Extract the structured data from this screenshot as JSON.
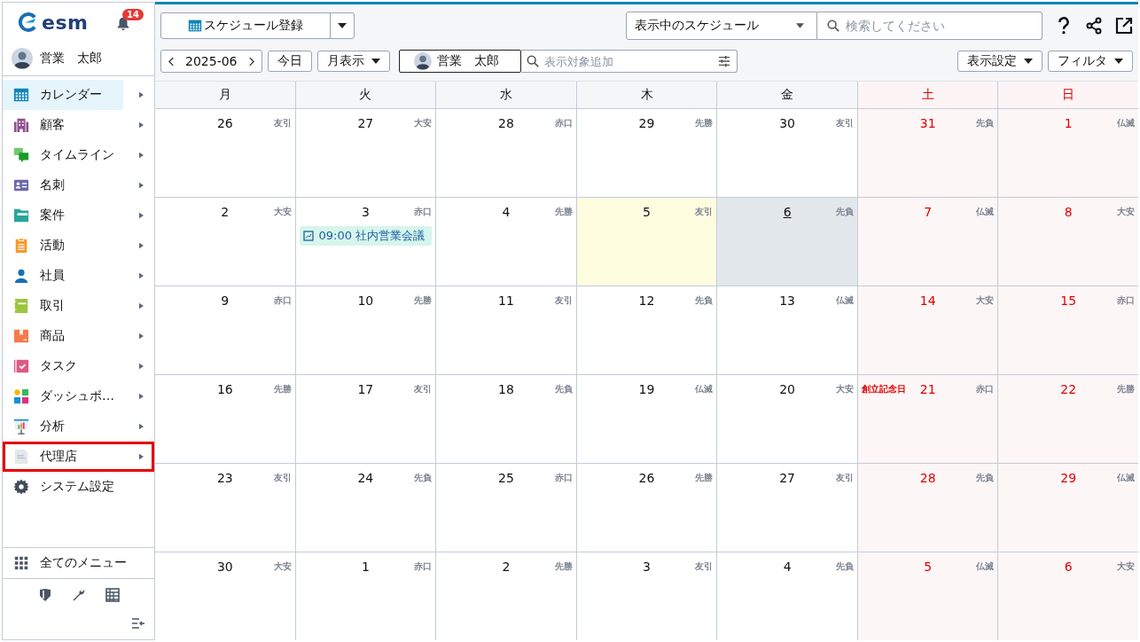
{
  "sidebar": {
    "logo": "esm",
    "notification_count": "14",
    "user": "営業　太郎",
    "items": [
      {
        "label": "カレンダー",
        "kind": "calendar",
        "selected": true,
        "highlighted": false,
        "submenu": true
      },
      {
        "label": "顧客",
        "kind": "building",
        "selected": false,
        "highlighted": false,
        "submenu": true
      },
      {
        "label": "タイムライン",
        "kind": "chat",
        "selected": false,
        "highlighted": false,
        "submenu": true
      },
      {
        "label": "名刺",
        "kind": "card",
        "selected": false,
        "highlighted": false,
        "submenu": true
      },
      {
        "label": "案件",
        "kind": "folder",
        "selected": false,
        "highlighted": false,
        "submenu": true
      },
      {
        "label": "活動",
        "kind": "clipboard",
        "selected": false,
        "highlighted": false,
        "submenu": true
      },
      {
        "label": "社員",
        "kind": "person",
        "selected": false,
        "highlighted": false,
        "submenu": true
      },
      {
        "label": "取引",
        "kind": "ledger",
        "selected": false,
        "highlighted": false,
        "submenu": true
      },
      {
        "label": "商品",
        "kind": "box",
        "selected": false,
        "highlighted": false,
        "submenu": true
      },
      {
        "label": "タスク",
        "kind": "task",
        "selected": false,
        "highlighted": false,
        "submenu": true
      },
      {
        "label": "ダッシュボ…",
        "kind": "dashboard",
        "selected": false,
        "highlighted": false,
        "submenu": true
      },
      {
        "label": "分析",
        "kind": "chart",
        "selected": false,
        "highlighted": false,
        "submenu": true
      },
      {
        "label": "代理店",
        "kind": "document",
        "selected": false,
        "highlighted": true,
        "submenu": true
      },
      {
        "label": "システム設定",
        "kind": "gear",
        "selected": false,
        "highlighted": false,
        "submenu": false
      }
    ],
    "all_menu": "全てのメニュー"
  },
  "toolbar": {
    "register_button": "スケジュール登録",
    "schedule_select": "表示中のスケジュール",
    "search": {
      "placeholder": "検索してください"
    },
    "month": "2025-06",
    "today_button": "今日",
    "view_select": "月表示",
    "user_chip": "営業　太郎",
    "target_search": {
      "placeholder": "表示対象追加"
    },
    "display_settings": "表示設定",
    "filter": "フィルタ"
  },
  "calendar": {
    "weekdays": [
      {
        "label": "月",
        "weekend": false
      },
      {
        "label": "火",
        "weekend": false
      },
      {
        "label": "水",
        "weekend": false
      },
      {
        "label": "木",
        "weekend": false
      },
      {
        "label": "金",
        "weekend": false
      },
      {
        "label": "土",
        "weekend": true
      },
      {
        "label": "日",
        "weekend": true
      }
    ],
    "weeks": [
      {
        "days": [
          {
            "date": "26",
            "rokuyo": "友引",
            "today": false,
            "selected": false
          },
          {
            "date": "27",
            "rokuyo": "大安",
            "today": false,
            "selected": false
          },
          {
            "date": "28",
            "rokuyo": "赤口",
            "today": false,
            "selected": false
          },
          {
            "date": "29",
            "rokuyo": "先勝",
            "today": false,
            "selected": false
          },
          {
            "date": "30",
            "rokuyo": "友引",
            "today": false,
            "selected": false
          },
          {
            "date": "31",
            "rokuyo": "先負",
            "today": false,
            "selected": false
          },
          {
            "date": "1",
            "rokuyo": "仏滅",
            "today": false,
            "selected": false
          }
        ]
      },
      {
        "days": [
          {
            "date": "2",
            "rokuyo": "大安",
            "today": false,
            "selected": false
          },
          {
            "date": "3",
            "rokuyo": "赤口",
            "today": false,
            "selected": false,
            "events": [
              {
                "time": "09:00",
                "title": "社内営業会議"
              }
            ]
          },
          {
            "date": "4",
            "rokuyo": "先勝",
            "today": false,
            "selected": false
          },
          {
            "date": "5",
            "rokuyo": "友引",
            "today": true,
            "selected": false
          },
          {
            "date": "6",
            "rokuyo": "先負",
            "today": false,
            "selected": true
          },
          {
            "date": "7",
            "rokuyo": "仏滅",
            "today": false,
            "selected": false
          },
          {
            "date": "8",
            "rokuyo": "大安",
            "today": false,
            "selected": false
          }
        ]
      },
      {
        "days": [
          {
            "date": "9",
            "rokuyo": "赤口",
            "today": false,
            "selected": false
          },
          {
            "date": "10",
            "rokuyo": "先勝",
            "today": false,
            "selected": false
          },
          {
            "date": "11",
            "rokuyo": "友引",
            "today": false,
            "selected": false
          },
          {
            "date": "12",
            "rokuyo": "先負",
            "today": false,
            "selected": false
          },
          {
            "date": "13",
            "rokuyo": "仏滅",
            "today": false,
            "selected": false
          },
          {
            "date": "14",
            "rokuyo": "大安",
            "today": false,
            "selected": false
          },
          {
            "date": "15",
            "rokuyo": "赤口",
            "today": false,
            "selected": false
          }
        ]
      },
      {
        "days": [
          {
            "date": "16",
            "rokuyo": "先勝",
            "today": false,
            "selected": false
          },
          {
            "date": "17",
            "rokuyo": "友引",
            "today": false,
            "selected": false
          },
          {
            "date": "18",
            "rokuyo": "先負",
            "today": false,
            "selected": false
          },
          {
            "date": "19",
            "rokuyo": "仏滅",
            "today": false,
            "selected": false
          },
          {
            "date": "20",
            "rokuyo": "大安",
            "today": false,
            "selected": false
          },
          {
            "date": "21",
            "rokuyo": "赤口",
            "today": false,
            "selected": false,
            "holiday": "創立記念日"
          },
          {
            "date": "22",
            "rokuyo": "先勝",
            "today": false,
            "selected": false
          }
        ]
      },
      {
        "days": [
          {
            "date": "23",
            "rokuyo": "友引",
            "today": false,
            "selected": false
          },
          {
            "date": "24",
            "rokuyo": "先負",
            "today": false,
            "selected": false
          },
          {
            "date": "25",
            "rokuyo": "赤口",
            "today": false,
            "selected": false
          },
          {
            "date": "26",
            "rokuyo": "先勝",
            "today": false,
            "selected": false
          },
          {
            "date": "27",
            "rokuyo": "友引",
            "today": false,
            "selected": false
          },
          {
            "date": "28",
            "rokuyo": "先負",
            "today": false,
            "selected": false
          },
          {
            "date": "29",
            "rokuyo": "仏滅",
            "today": false,
            "selected": false
          }
        ]
      },
      {
        "days": [
          {
            "date": "30",
            "rokuyo": "大安",
            "today": false,
            "selected": false
          },
          {
            "date": "1",
            "rokuyo": "赤口",
            "today": false,
            "selected": false
          },
          {
            "date": "2",
            "rokuyo": "先勝",
            "today": false,
            "selected": false
          },
          {
            "date": "3",
            "rokuyo": "友引",
            "today": false,
            "selected": false
          },
          {
            "date": "4",
            "rokuyo": "先負",
            "today": false,
            "selected": false
          },
          {
            "date": "5",
            "rokuyo": "仏滅",
            "today": false,
            "selected": false
          },
          {
            "date": "6",
            "rokuyo": "大安",
            "today": false,
            "selected": false
          }
        ]
      }
    ]
  }
}
